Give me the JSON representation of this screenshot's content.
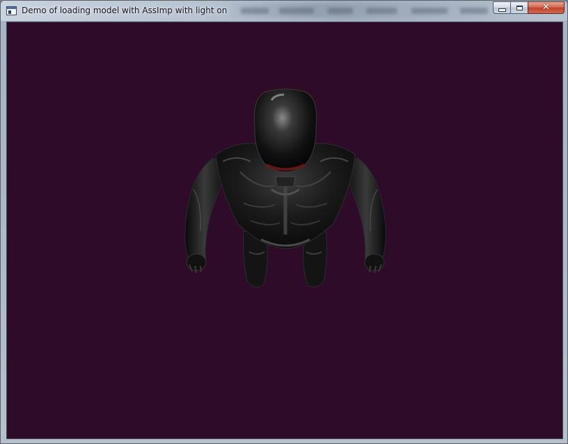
{
  "window": {
    "title": "Demo of loading model with AssImp with light on",
    "controls": {
      "minimize_glyph": "",
      "maximize_glyph": "",
      "close_glyph": "✕"
    },
    "icons": {
      "app": "app-window-icon",
      "minimize": "minimize-icon",
      "maximize": "maximize-icon",
      "close": "close-icon"
    }
  },
  "viewport": {
    "background_color": "#2e0b28",
    "model": "armored-humanoid-figure"
  },
  "colors": {
    "close_button": "#c7432c",
    "titlebar": "#b8c3d1"
  }
}
